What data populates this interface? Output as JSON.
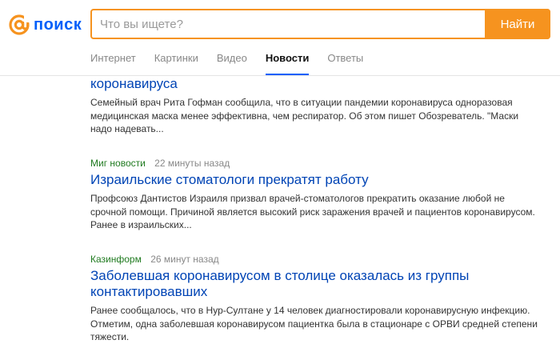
{
  "logo": {
    "text": "поиск"
  },
  "search": {
    "placeholder": "Что вы ищете?",
    "button_label": "Найти"
  },
  "tabs": [
    {
      "label": "Интернет",
      "active": false
    },
    {
      "label": "Картинки",
      "active": false
    },
    {
      "label": "Видео",
      "active": false
    },
    {
      "label": "Новости",
      "active": true
    },
    {
      "label": "Ответы",
      "active": false
    }
  ],
  "results": [
    {
      "source": "",
      "time": "",
      "title": "коронавируса",
      "snippet": "Семейный врач Рита Гофман сообщила, что в ситуации пандемии коронавируса одноразовая медицинская маска менее эффективна, чем респиратор. Об этом пишет Обозреватель. \"Маски надо надевать..."
    },
    {
      "source": "Миг новости",
      "time": "22 минуты назад",
      "title": "Израильские стоматологи прекратят работу",
      "snippet": "Профсоюз Дантистов Израиля призвал врачей-стоматологов прекратить оказание любой не срочной помощи. Причиной является высокий риск заражения врачей и пациентов коронавирусом. Ранее в израильских..."
    },
    {
      "source": "Казинформ",
      "time": "26 минут назад",
      "title": "Заболевшая коронавирусом в столице оказалась  из группы контактировавших",
      "snippet": "Ранее сообщалось, что в Нур-Султане у 14 человек диагностировали коронавирусную инфекцию. Отметим, одна заболевшая коронавирусом пациентка была в стационаре с ОРВИ средней степени тяжести."
    }
  ],
  "colors": {
    "brand": "#005ff9",
    "accent": "#f6931f",
    "link": "#0044b5",
    "source": "#1f7a1f"
  }
}
